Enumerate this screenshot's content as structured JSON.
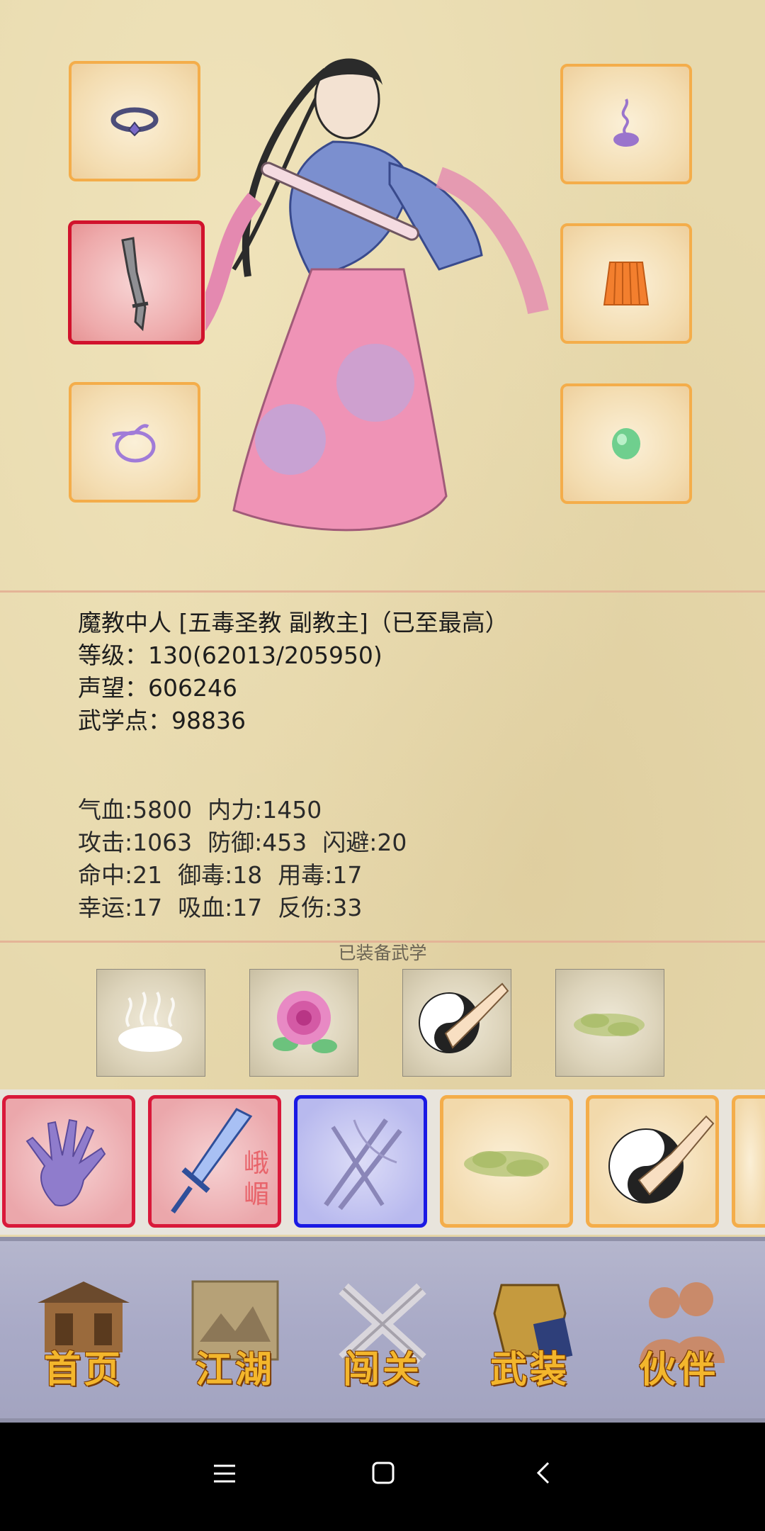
{
  "character": {
    "title_line": "魔教中人 [五毒圣教 副教主]（已至最高）",
    "level_line": "等级：130(62013/205950)",
    "reputation_line": "声望：606246",
    "martial_points_line": "武学点：98836"
  },
  "stats": {
    "row1": [
      "气血:5800",
      "内力:1450"
    ],
    "row2": [
      "攻击:1063",
      "防御:453",
      "闪避:20"
    ],
    "row3": [
      "命中:21",
      "御毒:18",
      "用毒:17"
    ],
    "row4": [
      "幸运:17",
      "吸血:17",
      "反伤:33"
    ]
  },
  "equipped_martial": {
    "title": "已装备武学"
  },
  "skills": {
    "sword_skill_text": "峨嵋"
  },
  "nav": [
    "首页",
    "江湖",
    "闯关",
    "武装",
    "伙伴"
  ],
  "icons": {
    "slots": [
      "ring-icon",
      "sabre-icon",
      "bracelet-icon",
      "incense-icon",
      "skirt-icon",
      "jade-icon"
    ],
    "martial": [
      "steam-cloud-icon",
      "rose-icon",
      "taiji-fist-icon",
      "green-cloud-icon"
    ],
    "skills": [
      "palm-icon",
      "crystal-sword-icon",
      "crossed-sticks-icon",
      "green-cloud-icon",
      "taiji-fist-icon"
    ],
    "system": [
      "menu-icon",
      "home-icon",
      "back-icon"
    ]
  },
  "colors": {
    "slot_border": "#f4ad4a",
    "selected_border": "#d1122c",
    "blue_border": "#1a19e4",
    "nav_text": "#f3b62c"
  }
}
